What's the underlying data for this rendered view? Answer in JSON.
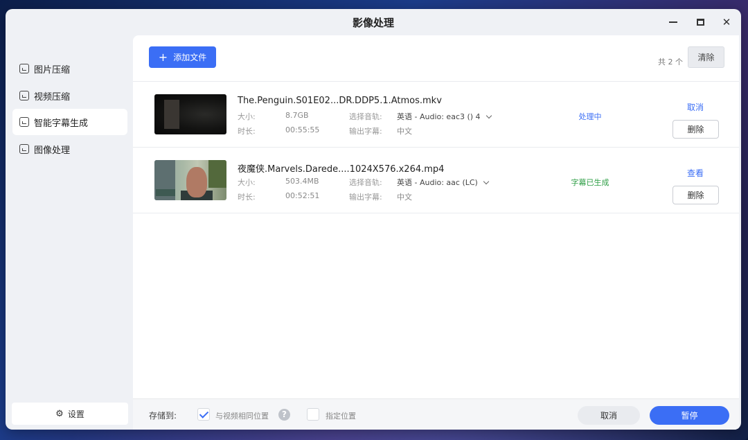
{
  "window": {
    "title": "影像处理"
  },
  "sidebar": {
    "items": [
      {
        "label": "图片压缩",
        "icon": "image-icon"
      },
      {
        "label": "视频压缩",
        "icon": "video-icon"
      },
      {
        "label": "智能字幕生成",
        "icon": "subtitle-icon"
      },
      {
        "label": "图像处理",
        "icon": "image-edit-icon"
      }
    ],
    "active_index": 2,
    "settings_label": "设置"
  },
  "toolbar": {
    "add_label": "添加文件",
    "count": "共 2 个",
    "clear_label": "清除"
  },
  "files": [
    {
      "name": "The.Penguin.S01E02...DR.DDP5.1.Atmos.mkv",
      "size_label": "大小:",
      "size": "8.7GB",
      "duration_label": "时长:",
      "duration": "00:55:55",
      "track_label": "选择音轨:",
      "track": "英语 - Audio: eac3 () 4",
      "subtitle_label": "输出字幕:",
      "subtitle": "中文",
      "status": "处理中",
      "action": "取消",
      "delete": "删除"
    },
    {
      "name": "夜魔侠.Marvels.Darede....1024X576.x264.mp4",
      "size_label": "大小:",
      "size": "503.4MB",
      "duration_label": "时长:",
      "duration": "00:52:51",
      "track_label": "选择音轨:",
      "track": "英语 - Audio: aac (LC)",
      "subtitle_label": "输出字幕:",
      "subtitle": "中文",
      "status": "字幕已生成",
      "action": "查看",
      "delete": "删除"
    }
  ],
  "footer": {
    "save_to": "存储到:",
    "same_location": "与视频相同位置",
    "same_location_checked": true,
    "custom_location": "指定位置",
    "custom_location_checked": false,
    "help": "?",
    "cancel": "取消",
    "pause": "暂停"
  },
  "colors": {
    "accent": "#3b6ef5",
    "processing": "#3b6ef5",
    "done": "#2e9e45"
  }
}
